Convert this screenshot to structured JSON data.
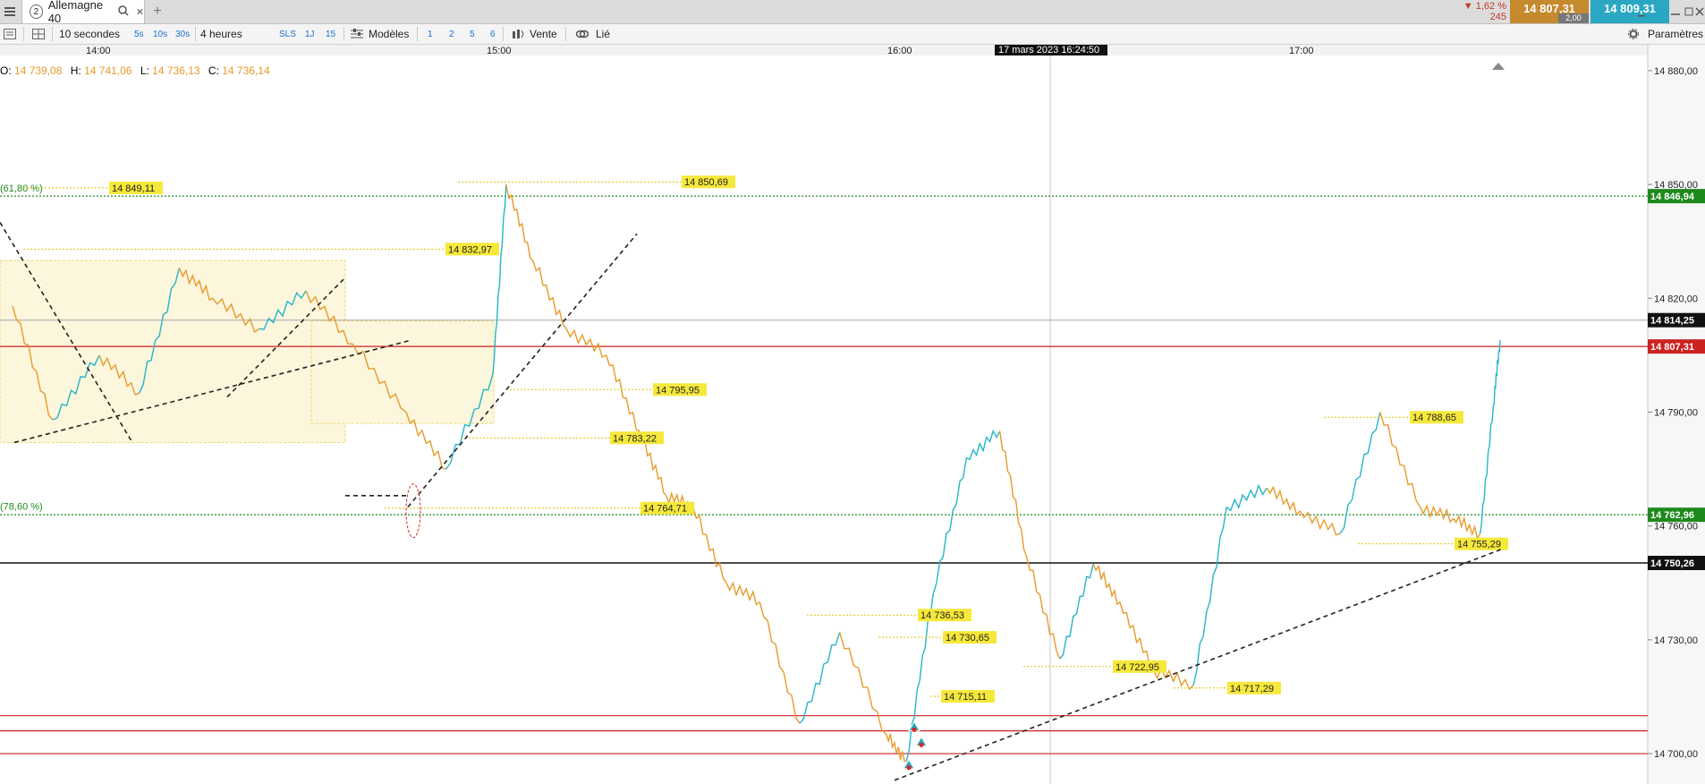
{
  "window": {
    "menu_icon": "hamburger-icon"
  },
  "tab": {
    "number": "2",
    "title": "Allemagne 40",
    "search_icon": "search-icon",
    "close_symbol": "✕",
    "new_tab_symbol": "+"
  },
  "header_right": {
    "change_pct": "▼ 1,62 %",
    "change_points": "245",
    "bid": "14 807,31",
    "spread": "2,00",
    "ask": "14 809,31",
    "colors": {
      "bid": "#c58a2e",
      "ask": "#2aa7c2",
      "down": "#c0392b"
    }
  },
  "toolbar": {
    "interval": "10 secondes",
    "quick_intervals": [
      "5s",
      "10s",
      "30s"
    ],
    "period": "4 heures",
    "quick_periods": [
      "SLS",
      "1J",
      "15"
    ],
    "templates": "Modèles",
    "slots": [
      "1",
      "2",
      "5",
      "6"
    ],
    "order_mode": "Vente",
    "linked": "Lié",
    "settings": "Paramètres"
  },
  "chart_data": {
    "type": "line",
    "instrument": "Allemagne 40",
    "time_ticks": [
      "14:00",
      "15:00",
      "16:00",
      "17:00"
    ],
    "crosshair_time": "17 mars 2023 16:24:50",
    "ohlc": {
      "O": "14 739,08",
      "H": "14 741,06",
      "L": "14 736,13",
      "C": "14 736,14"
    },
    "y_ticks": [
      "14 880,00",
      "14 850,00",
      "14 820,00",
      "14 790,00",
      "14 760,00",
      "14 730,00",
      "14 700,00"
    ],
    "ylim": [
      14692,
      14884
    ],
    "grid": false,
    "series": [
      {
        "color_up": "#26b5c8",
        "color_down": "#e89a2a",
        "time": [
          "13:47",
          "13:53",
          "14:00",
          "14:06",
          "14:12",
          "14:17",
          "14:24",
          "14:31",
          "14:38",
          "14:46",
          "14:52",
          "14:59",
          "15:01",
          "15:05",
          "15:10",
          "15:16",
          "15:21",
          "15:25",
          "15:29",
          "15:34",
          "15:39",
          "15:45",
          "15:51",
          "15:58",
          "16:01",
          "16:05",
          "16:10",
          "16:15",
          "16:19",
          "16:24",
          "16:29",
          "16:33",
          "16:38",
          "16:44",
          "16:49",
          "16:55",
          "17:00",
          "17:06",
          "17:12",
          "17:18",
          "17:23",
          "17:27",
          "17:29",
          "17:30"
        ],
        "price": [
          14818,
          14788,
          14805,
          14795,
          14828,
          14820,
          14812,
          14822,
          14808,
          14790,
          14775,
          14800,
          14850,
          14830,
          14812,
          14805,
          14785,
          14768,
          14765,
          14745,
          14740,
          14708,
          14732,
          14705,
          14698,
          14742,
          14778,
          14785,
          14752,
          14725,
          14750,
          14740,
          14722,
          14718,
          14765,
          14770,
          14764,
          14758,
          14790,
          14765,
          14762,
          14758,
          14792,
          14809
        ]
      }
    ],
    "horizontal_levels": [
      {
        "price": "14 846,94",
        "style": "dotted",
        "color": "#1e8a1e",
        "label_bg": "#1e8a1e"
      },
      {
        "price": "14 814,25",
        "style": "solid",
        "color": "#b0b0b0",
        "label_bg": "#111111"
      },
      {
        "price": "14 807,31",
        "style": "solid",
        "color": "#cc2222",
        "label_bg": "#cc2222"
      },
      {
        "price": "14 762,96",
        "style": "dotted",
        "color": "#1e8a1e",
        "label_bg": "#1e8a1e"
      },
      {
        "price": "14 750,26",
        "style": "solid",
        "color": "#111111",
        "label_bg": "#111111"
      },
      {
        "price": "14 710,00",
        "style": "solid",
        "color": "#cc2222",
        "label_bg": ""
      },
      {
        "price": "14 706,00",
        "style": "solid",
        "color": "#cc2222",
        "label_bg": ""
      },
      {
        "price": "14 700,00",
        "style": "solid",
        "color": "#cc2222",
        "label_bg": ""
      }
    ],
    "fib_labels": [
      "(61,80 %)",
      "(78,60 %)"
    ],
    "annotations": [
      "14 849,11",
      "14 850,69",
      "14 832,97",
      "14 795,95",
      "14 783,22",
      "14 764,71",
      "14 788,65",
      "14 755,29",
      "14 736,53",
      "14 730,65",
      "14 722,95",
      "14 717,29",
      "14 715,11"
    ],
    "markers": [
      "alert-bell-icon",
      "alert-bell-icon",
      "alert-bell-icon"
    ]
  }
}
